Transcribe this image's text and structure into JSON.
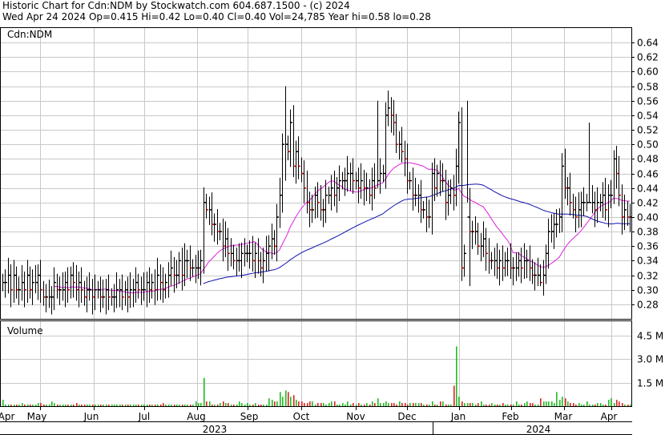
{
  "header": {
    "line1": "Historic Chart for Cdn:NDM by Stockwatch.com 604.687.1500 - (c) 2024",
    "line2": "Wed Apr 24 2024   Op=0.415   Hi=0.42   Lo=0.40   Cl=0.40   Vol=24,785   Year hi=0.58   lo=0.28"
  },
  "chart_data": [
    {
      "type": "ohlc",
      "title": "Cdn:NDM",
      "ylim": [
        0.26,
        0.66
      ],
      "y_ticks": [
        "0.64",
        "0.62",
        "0.60",
        "0.58",
        "0.56",
        "0.54",
        "0.52",
        "0.50",
        "0.48",
        "0.46",
        "0.44",
        "0.42",
        "0.40",
        "0.38",
        "0.36",
        "0.34",
        "0.32",
        "0.30",
        "0.28"
      ],
      "x_month_labels": [
        "Apr",
        "May",
        "Jun",
        "Jul",
        "Aug",
        "Sep",
        "Oct",
        "Nov",
        "Dec",
        "Jan",
        "Feb",
        "Mar",
        "Apr"
      ],
      "x_year_labels": [
        "2023",
        "2024"
      ],
      "grid": true,
      "colors": {
        "up_tick": "#000000",
        "down_tick": "#cc0000",
        "ma_short": "#e020e0",
        "ma_long": "#1010b0"
      },
      "closes": [
        0.31,
        0.31,
        0.32,
        0.3,
        0.32,
        0.3,
        0.3,
        0.31,
        0.3,
        0.32,
        0.3,
        0.31,
        0.31,
        0.32,
        0.3,
        0.29,
        0.29,
        0.29,
        0.29,
        0.31,
        0.3,
        0.3,
        0.3,
        0.31,
        0.3,
        0.32,
        0.31,
        0.3,
        0.31,
        0.3,
        0.29,
        0.3,
        0.3,
        0.29,
        0.3,
        0.3,
        0.29,
        0.29,
        0.3,
        0.29,
        0.29,
        0.29,
        0.3,
        0.3,
        0.29,
        0.3,
        0.29,
        0.3,
        0.3,
        0.31,
        0.3,
        0.3,
        0.3,
        0.31,
        0.3,
        0.31,
        0.3,
        0.32,
        0.31,
        0.3,
        0.31,
        0.32,
        0.33,
        0.32,
        0.32,
        0.34,
        0.32,
        0.34,
        0.34,
        0.33,
        0.33,
        0.33,
        0.33,
        0.34,
        0.42,
        0.41,
        0.41,
        0.39,
        0.39,
        0.38,
        0.38,
        0.36,
        0.37,
        0.35,
        0.35,
        0.34,
        0.34,
        0.34,
        0.35,
        0.35,
        0.35,
        0.35,
        0.34,
        0.35,
        0.34,
        0.33,
        0.34,
        0.35,
        0.36,
        0.37,
        0.36,
        0.4,
        0.43,
        0.5,
        0.5,
        0.49,
        0.53,
        0.47,
        0.49,
        0.47,
        0.46,
        0.44,
        0.42,
        0.41,
        0.41,
        0.43,
        0.42,
        0.41,
        0.41,
        0.43,
        0.43,
        0.44,
        0.43,
        0.44,
        0.45,
        0.45,
        0.45,
        0.46,
        0.46,
        0.45,
        0.45,
        0.44,
        0.45,
        0.44,
        0.44,
        0.43,
        0.45,
        0.44,
        0.45,
        0.46,
        0.46,
        0.54,
        0.55,
        0.54,
        0.53,
        0.5,
        0.5,
        0.49,
        0.48,
        0.45,
        0.45,
        0.43,
        0.43,
        0.43,
        0.41,
        0.41,
        0.4,
        0.4,
        0.46,
        0.44,
        0.46,
        0.45,
        0.45,
        0.42,
        0.43,
        0.44,
        0.43,
        0.47,
        0.53,
        0.33,
        0.35,
        0.4,
        0.38,
        0.38,
        0.38,
        0.36,
        0.36,
        0.37,
        0.35,
        0.34,
        0.34,
        0.34,
        0.33,
        0.34,
        0.33,
        0.34,
        0.34,
        0.33,
        0.33,
        0.33,
        0.34,
        0.33,
        0.34,
        0.34,
        0.33,
        0.32,
        0.32,
        0.32,
        0.31,
        0.32,
        0.35,
        0.38,
        0.38,
        0.39,
        0.39,
        0.4,
        0.47,
        0.44,
        0.44,
        0.42,
        0.41,
        0.4,
        0.41,
        0.42,
        0.42,
        0.42,
        0.42,
        0.42,
        0.41,
        0.42,
        0.42,
        0.43,
        0.41,
        0.43,
        0.43,
        0.48,
        0.46,
        0.43,
        0.4,
        0.41,
        0.4,
        0.4
      ]
    },
    {
      "type": "bar",
      "title": "Volume",
      "ylim": [
        0,
        5.4
      ],
      "y_ticks": [
        "4.5 M",
        "3.0 M",
        "1.5 M"
      ],
      "grid": true,
      "colors": {
        "up": "#22bb22",
        "down": "#dd2222"
      },
      "values_m": [
        0.4,
        0.1,
        0.1,
        0.1,
        0.1,
        0.1,
        0.1,
        0.2,
        0.1,
        0.1,
        0.1,
        0.1,
        0.1,
        0.2,
        0.2,
        0.1,
        0.1,
        0.1,
        0.3,
        0.2,
        0.1,
        0.1,
        0.1,
        0.1,
        0.1,
        0.1,
        0.1,
        0.2,
        0.1,
        0.1,
        0.1,
        0.1,
        0.1,
        0.1,
        0.1,
        0.1,
        0.1,
        0.1,
        0.1,
        0.1,
        0.1,
        0.1,
        0.1,
        0.1,
        0.1,
        0.1,
        0.1,
        0.1,
        0.1,
        0.1,
        0.1,
        0.1,
        0.1,
        0.1,
        0.1,
        0.1,
        0.1,
        0.1,
        0.1,
        0.2,
        0.1,
        0.1,
        0.1,
        0.1,
        0.1,
        0.1,
        0.1,
        0.1,
        0.1,
        0.1,
        0.1,
        0.3,
        0.2,
        0.2,
        1.8,
        0.3,
        0.3,
        0.1,
        0.1,
        0.1,
        0.2,
        0.3,
        0.2,
        0.2,
        0.1,
        0.1,
        0.1,
        0.3,
        0.2,
        0.1,
        0.2,
        0.1,
        0.1,
        0.2,
        0.1,
        0.1,
        0.1,
        0.1,
        0.5,
        0.4,
        0.3,
        0.3,
        0.9,
        0.6,
        1.0,
        0.9,
        0.6,
        0.7,
        0.4,
        0.3,
        0.3,
        0.2,
        0.2,
        0.3,
        0.3,
        0.1,
        0.2,
        0.2,
        0.2,
        0.1,
        0.2,
        0.3,
        0.3,
        0.1,
        0.1,
        0.2,
        0.1,
        0.3,
        0.1,
        0.2,
        0.1,
        0.2,
        0.1,
        0.1,
        0.2,
        0.1,
        0.3,
        0.2,
        0.5,
        0.2,
        0.2,
        0.3,
        0.2,
        0.2,
        0.2,
        0.1,
        0.3,
        0.2,
        0.2,
        0.1,
        0.2,
        0.2,
        0.2,
        0.2,
        0.2,
        0.1,
        0.1,
        0.1,
        0.3,
        0.1,
        0.1,
        0.3,
        0.3,
        0.1,
        0.1,
        0.1,
        1.3,
        3.8,
        0.6,
        0.3,
        0.2,
        0.2,
        0.2,
        0.2,
        0.1,
        0.2,
        0.3,
        0.1,
        0.1,
        0.1,
        0.2,
        0.1,
        0.1,
        0.1,
        0.2,
        0.1,
        0.1,
        0.1,
        0.1,
        0.3,
        0.1,
        0.1,
        0.2,
        0.3,
        0.2,
        0.2,
        0.1,
        0.1,
        0.5,
        0.3,
        0.3,
        0.3,
        0.3,
        0.2,
        0.9,
        0.4,
        0.6,
        0.5,
        0.3,
        0.2,
        0.2,
        0.1,
        0.2,
        0.1,
        0.1,
        0.3,
        0.1,
        0.1,
        0.1,
        0.2,
        0.2,
        0.1,
        0.1,
        0.4,
        0.5,
        0.2,
        0.4,
        0.3,
        0.2,
        0.1,
        0.1,
        0.1
      ]
    }
  ]
}
